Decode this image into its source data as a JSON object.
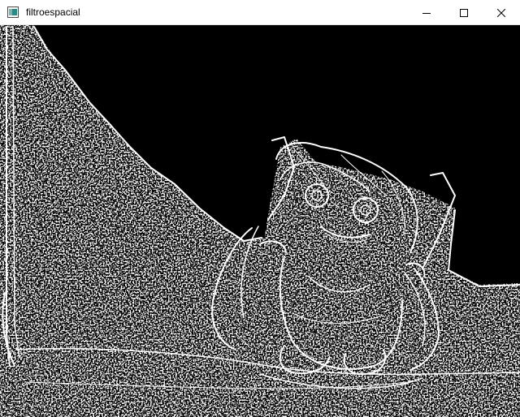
{
  "window": {
    "title": "filtroespacial",
    "icon": "opencv-window-icon",
    "controls": {
      "minimize": "minimize-icon",
      "maximize": "maximize-icon",
      "close": "close-icon"
    }
  },
  "image": {
    "description_tag": "edge-filtered-figure-image",
    "background_color": "#000000",
    "edge_color": "#ffffff"
  }
}
